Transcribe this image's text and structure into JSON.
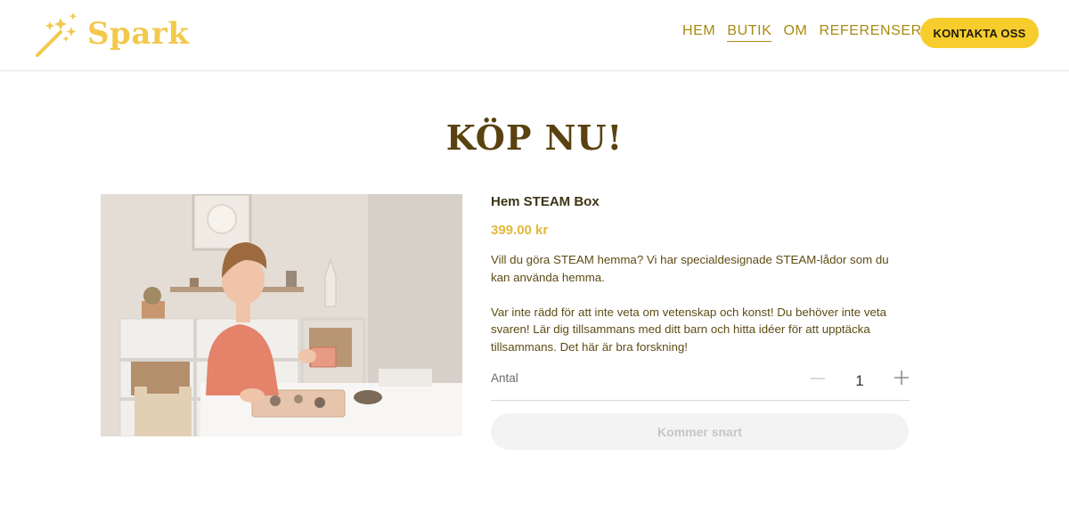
{
  "brand": {
    "name": "Spark",
    "accent": "#f7cd2e",
    "text_color": "#a88a10"
  },
  "nav": {
    "items": [
      {
        "label": "HEM",
        "active": false
      },
      {
        "label": "BUTIK",
        "active": true
      },
      {
        "label": "OM",
        "active": false
      },
      {
        "label": "REFERENSER",
        "active": false
      }
    ],
    "cta_label": "KONTAKTA OSS"
  },
  "page": {
    "title": "KÖP NU!"
  },
  "product": {
    "image_icon": "product-photo-child-playing",
    "name": "Hem STEAM Box",
    "price": "399.00 kr",
    "description": [
      "Vill du göra STEAM hemma? Vi har specialdesignade STEAM-lådor som du kan använda hemma.",
      "Var inte rädd för att inte veta om vetenskap och konst! Du behöver inte veta svaren! Lär dig tillsammans med ditt barn och hitta idéer för att upp­täcka tillsammans. Det här är bra forskning!"
    ],
    "quantity_label": "Antal",
    "quantity": "1",
    "button_label": "Kommer snart"
  }
}
